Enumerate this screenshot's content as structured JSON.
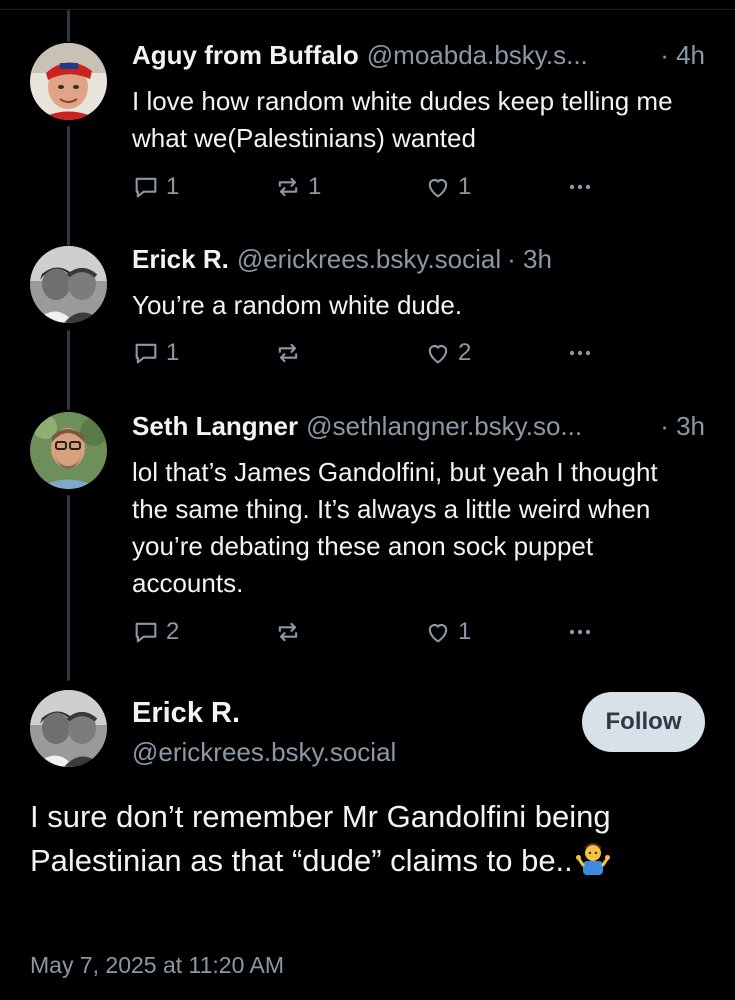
{
  "posts": [
    {
      "author_name": "Aguy from Buffalo",
      "handle": "@moabda.bsky.s...",
      "time": "· 4h",
      "text": "I love how random white dudes keep telling me what we(Palestinians) wanted",
      "reply_count": "1",
      "repost_count": "1",
      "like_count": "1"
    },
    {
      "author_name": "Erick R.",
      "handle": "@erickrees.bsky.social",
      "time": "· 3h",
      "text": "You’re a random white dude.",
      "reply_count": "1",
      "repost_count": "",
      "like_count": "2"
    },
    {
      "author_name": "Seth Langner",
      "handle": "@sethlangner.bsky.so...",
      "time": "· 3h",
      "text": "lol that’s James Gandolfini, but yeah I thought the same thing. It’s always a little weird when you’re debating these anon sock puppet accounts.",
      "reply_count": "2",
      "repost_count": "",
      "like_count": "1"
    }
  ],
  "focus": {
    "author_name": "Erick R.",
    "handle": "@erickrees.bsky.social",
    "follow_label": "Follow",
    "text": "I sure don’t remember Mr Gandolfini being Palestinian as that “dude” claims to be..",
    "emoji": "person-shrugging-emoji",
    "date": "May 7, 2025 at 11:20 AM"
  },
  "icons": {
    "reply": "reply-icon",
    "repost": "repost-icon",
    "like": "heart-icon",
    "more": "more-options-icon"
  },
  "colors": {
    "background": "#000000",
    "text": "#f1f3f5",
    "muted": "#8b98a5",
    "thread_line": "#2e3840",
    "follow_button": "#d9e1e8"
  }
}
